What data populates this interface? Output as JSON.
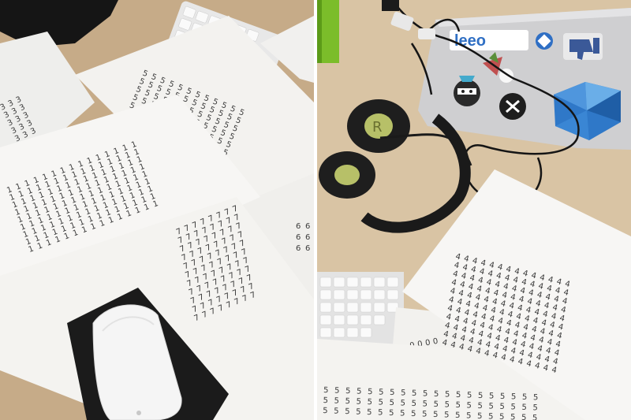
{
  "photo": {
    "left_panel": {
      "sheets": [
        {
          "id": "sheet-digit-1",
          "digit": "1"
        },
        {
          "id": "sheet-digit-5",
          "digit": "5"
        },
        {
          "id": "sheet-digit-7",
          "digit": "7"
        },
        {
          "id": "sheet-digit-3",
          "digit": "3"
        },
        {
          "id": "sheet-digit-6",
          "digit": "6"
        }
      ]
    },
    "right_panel": {
      "sheets": [
        {
          "id": "sheet-digit-4",
          "digit": "4"
        },
        {
          "id": "sheet-digit-5b",
          "digit": "5"
        },
        {
          "id": "sheet-digit-0",
          "digit": "0"
        }
      ],
      "stickers": {
        "brand_text": "leeo"
      }
    }
  },
  "colors": {
    "desk": "#cbb291",
    "paper": "#f4f3f1",
    "laptop": "#c9c9cb",
    "headphones": "#1c1c1e",
    "mouse": "#f2f2f2",
    "mousepad": "#1a1a1a",
    "sticker_blue": "#2f6fc4"
  }
}
